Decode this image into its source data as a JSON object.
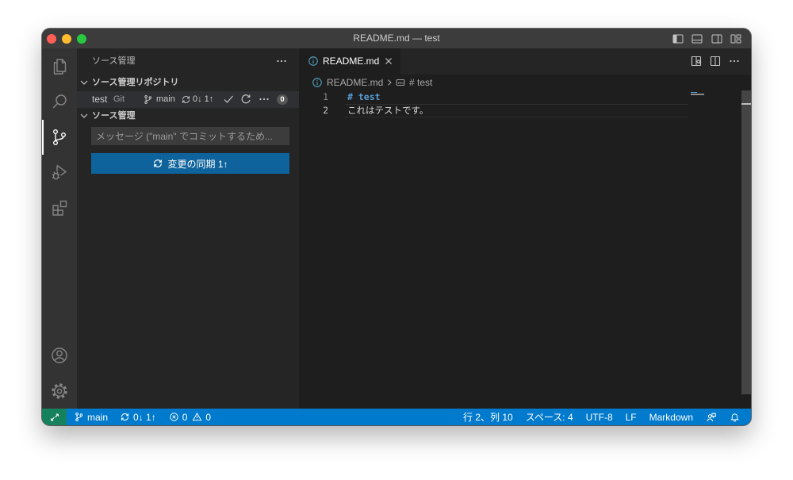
{
  "window": {
    "title": "README.md — test",
    "controls": [
      "close-window",
      "minimize-window",
      "zoom-window"
    ]
  },
  "title_bar": {
    "icons": [
      "toggle-primary-sidebar-icon",
      "toggle-panel-icon",
      "toggle-secondary-sidebar-icon",
      "customize-layout-icon"
    ]
  },
  "activity_bar": {
    "items": [
      "files-icon",
      "search-icon",
      "source-control-icon",
      "run-debug-icon",
      "extensions-icon"
    ],
    "bottom_items": [
      "account-icon",
      "gear-icon"
    ],
    "active": "source-control-icon"
  },
  "sidebar": {
    "title": "ソース管理",
    "repositories": {
      "title": "ソース管理リポジトリ",
      "repo": {
        "name": "test",
        "provider": "Git",
        "branch": "main",
        "sync": "0↓ 1↑",
        "changes_count": "0"
      }
    },
    "changes": {
      "title": "ソース管理",
      "commit_placeholder": "メッセージ (\"main\" でコミットするため...",
      "sync_button_label": "変更の同期 1↑"
    }
  },
  "editor": {
    "tab": {
      "label": "README.md",
      "icon": "info-icon"
    },
    "actions": [
      "open-preview-to-side-icon",
      "split-editor-icon",
      "more-actions-icon"
    ],
    "breadcrumb": {
      "file": "README.md",
      "symbol": "# test"
    },
    "lines": [
      {
        "number": "1",
        "text": "# test"
      },
      {
        "number": "2",
        "text": "これはテストです。"
      }
    ],
    "current_line": 2
  },
  "status_bar": {
    "branch": "main",
    "sync": "0↓ 1↑",
    "errors": "0",
    "warnings": "0",
    "cursor": "行 2、列 10",
    "indent": "スペース: 4",
    "encoding": "UTF-8",
    "eol": "LF",
    "language": "Markdown"
  },
  "colors": {
    "status_bar": "#007acc",
    "remote_indicator": "#16825d",
    "primary_button": "#0e639c",
    "markdown_heading": "#569cd6",
    "file_icon": "#519aba"
  }
}
